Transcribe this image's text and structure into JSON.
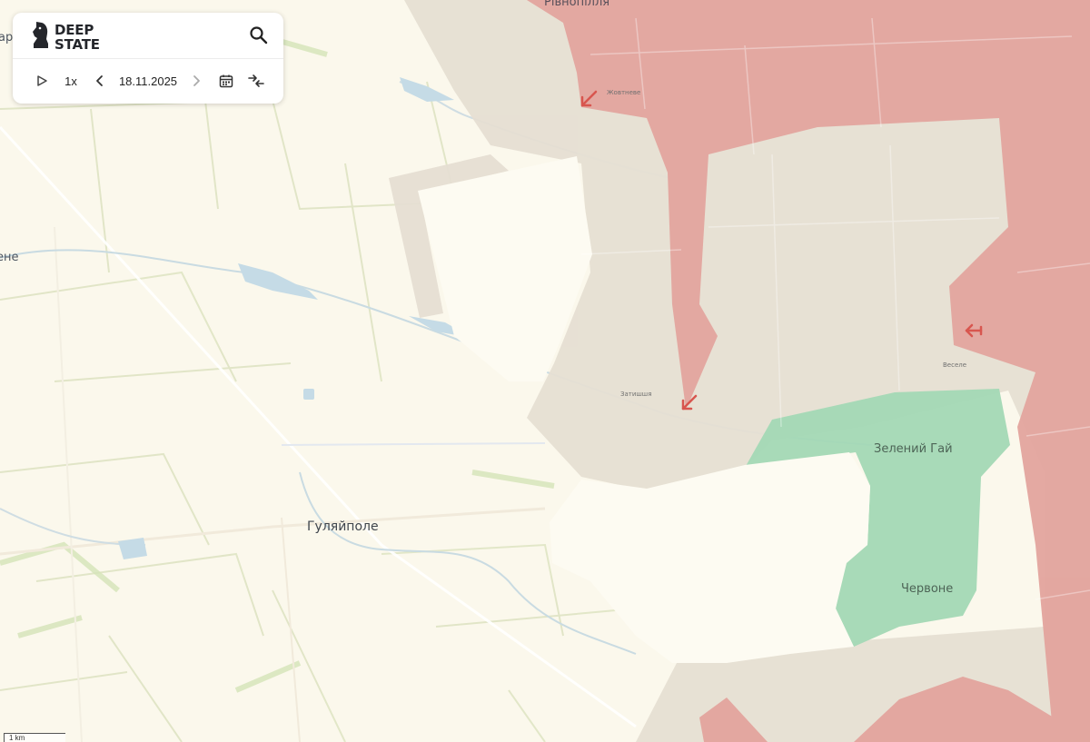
{
  "map": {
    "labels": {
      "city": "Гуляйполе",
      "zeleny_hai": "Зелений Гай",
      "chervone": "Червоне",
      "rivnopillia": "Рівнопілля",
      "zhovtneve": "Жовтневе",
      "zatyshshia": "Затишшя",
      "vesele": "Веселе",
      "left_edge_1": "арі",
      "left_edge_2": "ене"
    },
    "scale_label": "1 km",
    "zones": {
      "occupied_color": "#e3a49e",
      "contested_color": "#e6dfd3",
      "liberated_color": "#a3d8b5",
      "water_color": "#c5dbe6",
      "arrow_color": "#d8564f"
    }
  },
  "panel": {
    "brand_line1": "DEEP",
    "brand_line2": "STATE",
    "speed_label": "1x",
    "date_value": "18.11.2025",
    "icons": {
      "logo": "knight-chess-icon",
      "search": "search-icon",
      "play": "play-icon",
      "prev": "chevron-left-icon",
      "next": "chevron-right-icon",
      "calendar": "calendar-icon",
      "compare": "compare-arrows-icon"
    }
  }
}
